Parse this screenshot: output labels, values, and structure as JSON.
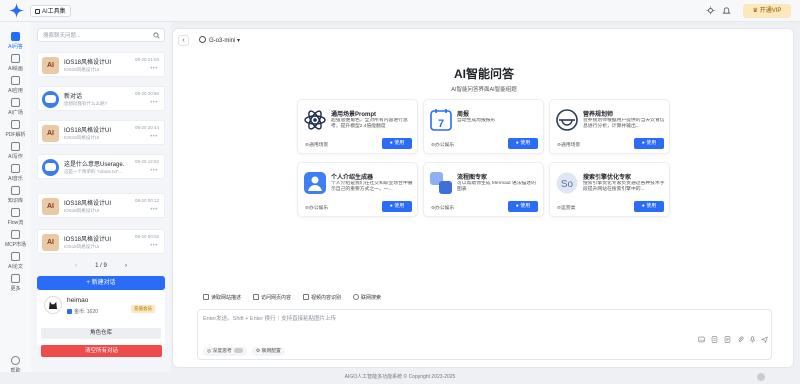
{
  "topbar": {
    "app_title": "AI工具集",
    "vip_label": "开通VIP"
  },
  "rail": [
    {
      "label": "AI问答",
      "icon": "chat-icon",
      "active": true
    },
    {
      "label": "AI绘画",
      "icon": "image-icon"
    },
    {
      "label": "AI应用",
      "icon": "apps-icon"
    },
    {
      "label": "AI广场",
      "icon": "square-icon"
    },
    {
      "label": "PDF解析",
      "icon": "pdf-icon"
    },
    {
      "label": "AI写作",
      "icon": "pen-icon"
    },
    {
      "label": "AI音乐",
      "icon": "music-icon"
    },
    {
      "label": "知识库",
      "icon": "book-icon"
    },
    {
      "label": "Flow流",
      "icon": "flow-icon"
    },
    {
      "label": "MCP市场",
      "icon": "market-icon"
    },
    {
      "label": "AI论文",
      "icon": "paper-icon"
    },
    {
      "label": "更多",
      "icon": "more-icon"
    },
    {
      "label": "帮助",
      "icon": "help-icon"
    }
  ],
  "sidebar": {
    "search_placeholder": "搜索聊天问题...",
    "conversations": [
      {
        "title": "IOS18风格设计UI",
        "subtitle": "IOS18风格设计UI",
        "time": "08-20 21:04",
        "avatar": "ai"
      },
      {
        "title": "新对话",
        "subtitle": "您想问我有什么么呢?",
        "time": "08-20 20:50",
        "avatar": "chat"
      },
      {
        "title": "IOS18风格设计UI",
        "subtitle": "IOS18风格设计UI",
        "time": "08-20 20:44",
        "avatar": "ai"
      },
      {
        "title": "这是什么意思Userage...",
        "subtitle": "这是一个简单的 \"robots.txt\"...",
        "time": "08-20 12:52",
        "avatar": "chat"
      },
      {
        "title": "IOS18风格设计UI",
        "subtitle": "IOS18风格设计UI",
        "time": "08-20 00:12",
        "avatar": "ai"
      },
      {
        "title": "IOS18风格设计UI",
        "subtitle": "IOS18风格设计UI",
        "time": "08-20 00:02",
        "avatar": "ai"
      }
    ],
    "avatar_letters": "AI",
    "pager": {
      "current": "1",
      "sep": "/",
      "total": "9",
      "prev": "‹",
      "next": "›"
    },
    "new_chat_label": "+  新建对话",
    "user": {
      "name": "heimao",
      "coins_label": "金币: 1620",
      "badge": "充值会员"
    },
    "store_label": "角色仓库",
    "clear_label": "清空所有对话"
  },
  "main": {
    "back": "‹",
    "model": "G-o3-mini",
    "model_caret": "▾",
    "title": "AI智能问答",
    "subtitle": "AI智能问答界面AI智能组题",
    "cards": [
      {
        "title": "通用场景Prompt",
        "desc": "超强思维角色，全对所有内容进行思考，提升模型2.4倍能翻度",
        "tag": "⊘通用场景",
        "use": "使用",
        "icon": "atom-icon"
      },
      {
        "title": "周报",
        "desc": "自动生成周报报形",
        "tag": "⊘办公娱乐",
        "use": "使用",
        "icon": "calendar-icon"
      },
      {
        "title": "营养规划师",
        "desc": "营养规划师根据用户提供的当天饮食信息进行分析，计算并输出...",
        "tag": "⊘通用场景",
        "use": "使用",
        "icon": "nutrition-icon"
      },
      {
        "title": "个人介绍生成器",
        "desc": "个人介绍是我们在社交和职业场合中展示自己的重要方式之一。一...",
        "tag": "⊘办公娱乐",
        "use": "使用",
        "icon": "person-icon"
      },
      {
        "title": "流程图专家",
        "desc": "可以帮助你生成 Mermaid 语法描述的图表",
        "tag": "⊘办公娱乐",
        "use": "使用",
        "icon": "flowchart-icon"
      },
      {
        "title": "搜索引擎优化专家",
        "desc": "搜索引擎优化专家负责通过各种技术手段提升网站在搜索引擎中的...",
        "tag": "⊘运营类",
        "use": "使用",
        "icon": "seo-icon"
      }
    ],
    "tools": [
      {
        "label": "读取网站描述",
        "icon": "web-icon"
      },
      {
        "label": "访问网页内容",
        "icon": "page-icon"
      },
      {
        "label": "视频内容识别",
        "icon": "video-icon"
      },
      {
        "label": "联网搜索",
        "icon": "globe-icon"
      }
    ],
    "input_placeholder": "Enter发送。Shift + Enter 换行｜支持直接粘贴图片上传",
    "deep_think": "深度思考",
    "web_config": "联网配置"
  },
  "footer": "AIGO人工智能多功能系统 © Copyright 2023-2025",
  "colors": {
    "primary": "#2a6cf5",
    "danger": "#ee4b4b",
    "vip": "#fde7bd"
  }
}
